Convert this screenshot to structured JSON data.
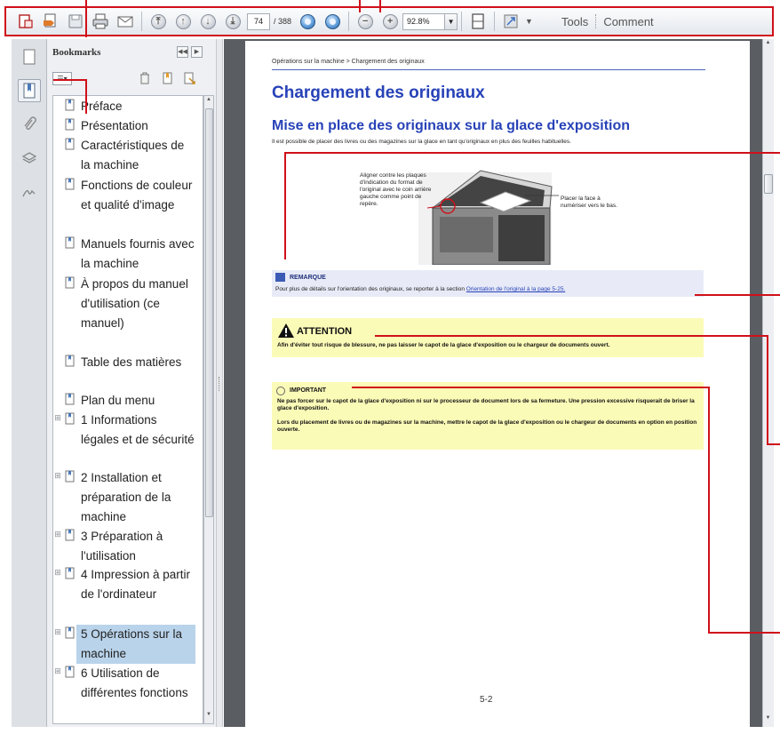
{
  "toolbar": {
    "page_current": "74",
    "page_total": "/ 388",
    "zoom": "92.8%",
    "tools_label": "Tools",
    "comment_label": "Comment",
    "icons": [
      "create-icon",
      "open-icon",
      "save-icon",
      "print-icon",
      "email-icon",
      "first-page-icon",
      "previous-page-icon",
      "next-page-icon",
      "last-page-icon",
      "previous-view-icon",
      "next-view-icon",
      "zoom-out-icon",
      "zoom-in-icon",
      "fit-page-icon",
      "read-mode-icon"
    ]
  },
  "sidebar": {
    "panel_title": "Bookmarks",
    "options_label": "☰▾",
    "items": [
      {
        "label": "Préface",
        "expandable": false
      },
      {
        "label": "Présentation",
        "expandable": false
      },
      {
        "label": "Caractéristiques de la machine",
        "expandable": false
      },
      {
        "label": "Fonctions de couleur et qualité d'image",
        "expandable": false
      },
      {
        "label": "Manuels fournis avec la machine",
        "expandable": false
      },
      {
        "label": "À propos du manuel d'utilisation (ce manuel)",
        "expandable": false
      },
      {
        "label": "Table des matières",
        "expandable": false
      },
      {
        "label": "Plan du menu",
        "expandable": false
      },
      {
        "label": "1 Informations légales et de sécurité",
        "expandable": true
      },
      {
        "label": "2 Installation et préparation de la machine",
        "expandable": true
      },
      {
        "label": "3 Préparation à l'utilisation",
        "expandable": true
      },
      {
        "label": "4 Impression à partir de l'ordinateur",
        "expandable": true
      },
      {
        "label": "5 Opérations sur la machine",
        "expandable": true,
        "selected": true
      },
      {
        "label": "6 Utilisation de différentes fonctions",
        "expandable": true
      }
    ]
  },
  "document": {
    "breadcrumb": "Opérations sur la machine > Chargement des originaux",
    "title": "Chargement des originaux",
    "subtitle": "Mise en place des originaux sur la glace d'exposition",
    "intro": "Il est possible de placer des livres ou des magazines sur la glace en tant qu'originaux en plus des feuilles habituelles.",
    "figure_note_left": "Aligner contre les plaques d'indication du format de l'original avec le coin arrière gauche comme point de repère.",
    "figure_note_right": "Placer la face à numériser vers le bas.",
    "remarque_title": "REMARQUE",
    "remarque_text": "Pour plus de détails sur l'orientation des originaux, se reporter à la section ",
    "remarque_link": "Orientation de l'original à la page 5-25.",
    "attention_title": "ATTENTION",
    "attention_text": "Afin d'éviter tout risque de blessure, ne pas laisser le capot de la glace d'exposition ou le chargeur de documents ouvert.",
    "important_title": "IMPORTANT",
    "important_text_1": "Ne pas forcer sur le capot de la glace d'exposition ni sur le processeur de document lors de sa fermeture. Une pression excessive risquerait de briser la glace d'exposition.",
    "important_text_2": "Lors du placement de livres ou de magazines sur la machine, mettre le capot de la glace d'exposition ou le chargeur de documents en option en position ouverte.",
    "page_number": "5-2"
  },
  "colors": {
    "callout": "#d0101a",
    "heading": "#2742b8",
    "note_bg": "#e8ebf7",
    "warning_bg": "#fbfbb8",
    "selection": "#b9d3ea"
  }
}
